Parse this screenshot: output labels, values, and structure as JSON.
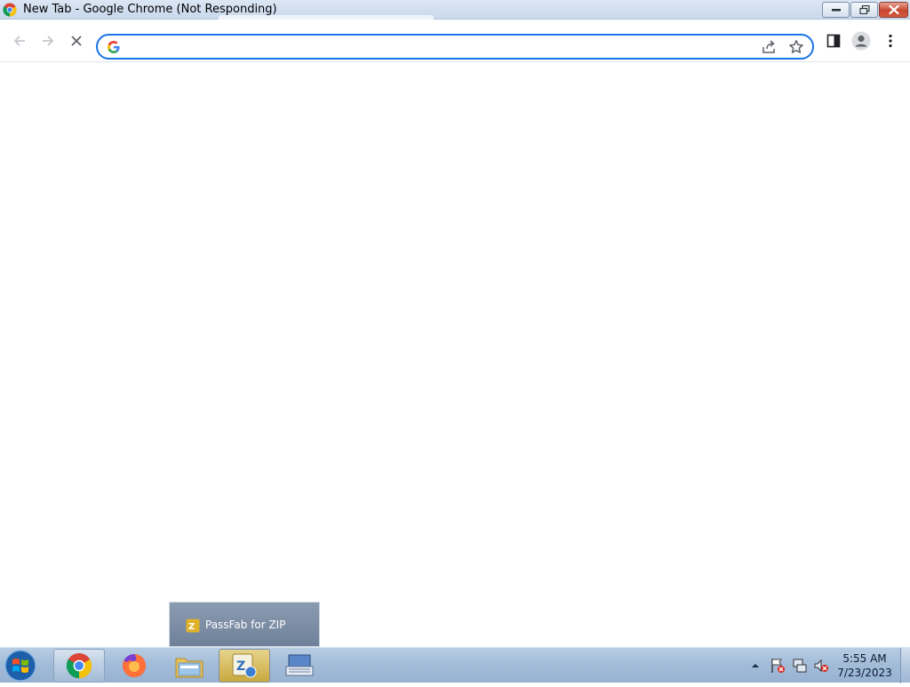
{
  "window": {
    "title": "New Tab - Google Chrome (Not Responding)",
    "icon": "chrome-icon",
    "controls": {
      "minimize": "minimize-icon",
      "maximize": "restore-icon",
      "close": "close-icon"
    }
  },
  "toolbar": {
    "back": "arrow-left-icon",
    "forward": "arrow-right-icon",
    "stop": "close-x-icon",
    "omnibox": {
      "value": "",
      "icon": "google-g-icon"
    },
    "share": "share-icon",
    "bookmark": "star-icon",
    "side_panel": "side-panel-icon",
    "profile": "profile-icon",
    "menu": "kebab-menu-icon"
  },
  "taskbar": {
    "apps": [
      {
        "name": "Google Chrome",
        "icon": "chrome-icon"
      },
      {
        "name": "Firefox",
        "icon": "firefox-icon"
      },
      {
        "name": "Windows Explorer",
        "icon": "folder-icon"
      },
      {
        "name": "PassFab for ZIP",
        "icon": "passfab-zip-icon"
      },
      {
        "name": "On-Screen Keyboard",
        "icon": "keyboard-icon"
      }
    ],
    "thumbnail_popup": {
      "label": "PassFab for ZIP"
    },
    "clock": {
      "time": "5:55 AM",
      "date": "7/23/2023"
    }
  },
  "colors": {
    "focus_ring": "#1a73e8",
    "taskbar": "#a3bcd8",
    "titlebar": "#dbe6f4"
  }
}
